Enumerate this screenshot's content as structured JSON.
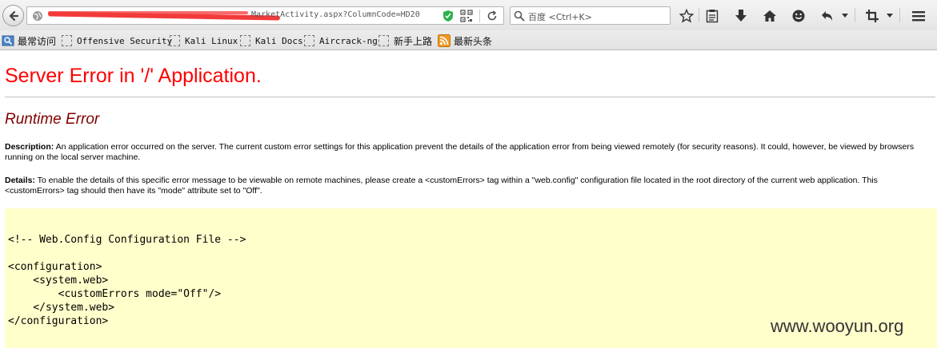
{
  "browser": {
    "url_visible_text": "MarketActivity.aspx?ColumnCode=HD20",
    "search_placeholder": "百度 <Ctrl+K>"
  },
  "bookmarks": [
    {
      "label": "最常访问",
      "icon": "bookmark-folder-icon"
    },
    {
      "label": "Offensive Security",
      "icon": "page-icon"
    },
    {
      "label": "Kali Linux",
      "icon": "page-icon"
    },
    {
      "label": "Kali Docs",
      "icon": "page-icon"
    },
    {
      "label": "Aircrack-ng",
      "icon": "page-icon"
    },
    {
      "label": "新手上路",
      "icon": "page-icon"
    },
    {
      "label": "最新头条",
      "icon": "rss-feed-icon"
    }
  ],
  "page": {
    "title": "Server Error in '/' Application.",
    "subtitle": "Runtime Error",
    "description_label": "Description:",
    "description_text": " An application error occurred on the server. The current custom error settings for this application prevent the details of the application error from being viewed remotely (for security reasons). It could, however, be viewed by browsers running on the local server machine.",
    "details_label": "Details:",
    "details_text": " To enable the details of this specific error message to be viewable on remote machines, please create a <customErrors> tag within a \"web.config\" configuration file located in the root directory of the current web application. This <customErrors> tag should then have its \"mode\" attribute set to \"Off\".",
    "code": "<!-- Web.Config Configuration File -->\n\n<configuration>\n    <system.web>\n        <customErrors mode=\"Off\"/>\n    </system.web>\n</configuration>"
  },
  "watermark": "www.wooyun.org"
}
